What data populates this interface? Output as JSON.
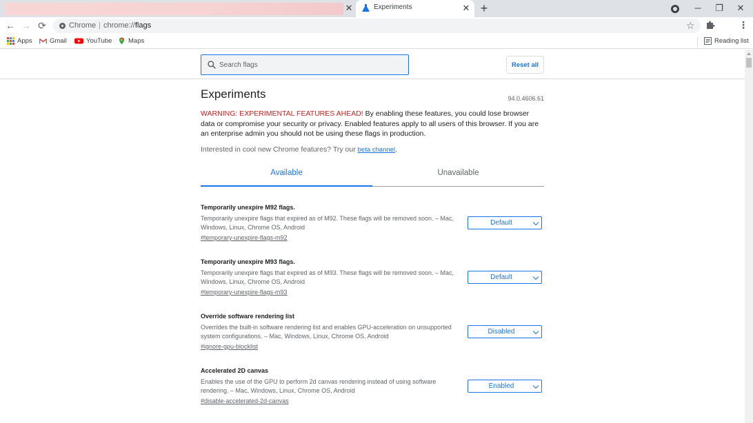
{
  "browser": {
    "active_tab_title": "Experiments",
    "close_symbol": "✕",
    "new_tab_symbol": "+",
    "window_controls": {
      "minimize": "─",
      "restore": "❐",
      "close": "✕"
    },
    "nav": {
      "back": "←",
      "forward": "→",
      "reload": "⟳"
    },
    "omnibox": {
      "scheme_label": "Chrome",
      "separator": "|",
      "url_prefix": "chrome://",
      "url_path": "flags"
    },
    "star_symbol": "☆",
    "menu_symbol": "⋮"
  },
  "bookmarks": {
    "items": [
      {
        "label": "Apps",
        "icon": "apps-grid-icon"
      },
      {
        "label": "Gmail",
        "icon": "gmail-icon"
      },
      {
        "label": "YouTube",
        "icon": "youtube-icon"
      },
      {
        "label": "Maps",
        "icon": "maps-icon"
      }
    ],
    "reading_list": "Reading list"
  },
  "page": {
    "search_placeholder": "Search flags",
    "reset_all": "Reset all",
    "title": "Experiments",
    "version": "94.0.4606.61",
    "warning_prefix": "WARNING: EXPERIMENTAL FEATURES AHEAD!",
    "warning_body": " By enabling these features, you could lose browser data or compromise your security or privacy. Enabled features apply to all users of this browser. If you are an enterprise admin you should not be using these flags in production.",
    "interested_text": "Interested in cool new Chrome features? Try our ",
    "beta_link": "beta channel",
    "interested_suffix": ".",
    "tabs": {
      "available": "Available",
      "unavailable": "Unavailable"
    }
  },
  "flags": [
    {
      "name": "Temporarily unexpire M92 flags.",
      "description": "Temporarily unexpire flags that expired as of M92. These flags will be removed soon. – Mac, Windows, Linux, Chrome OS, Android",
      "link": "#temporary-unexpire-flags-m92",
      "value": "Default"
    },
    {
      "name": "Temporarily unexpire M93 flags.",
      "description": "Temporarily unexpire flags that expired as of M93. These flags will be removed soon. – Mac, Windows, Linux, Chrome OS, Android",
      "link": "#temporary-unexpire-flags-m93",
      "value": "Default"
    },
    {
      "name": "Override software rendering list",
      "description": "Overrides the built-in software rendering list and enables GPU-acceleration on unsupported system configurations. – Mac, Windows, Linux, Chrome OS, Android",
      "link": "#ignore-gpu-blocklist",
      "value": "Disabled"
    },
    {
      "name": "Accelerated 2D canvas",
      "description": "Enables the use of the GPU to perform 2d canvas rendering instead of using software rendering. – Mac, Windows, Linux, Chrome OS, Android",
      "link": "#disable-accelerated-2d-canvas",
      "value": "Enabled"
    }
  ],
  "colors": {
    "accent": "#1a73e8",
    "warning": "#c5221f",
    "tabstrip": "#dee1e6",
    "muted_text": "#5f6368"
  }
}
